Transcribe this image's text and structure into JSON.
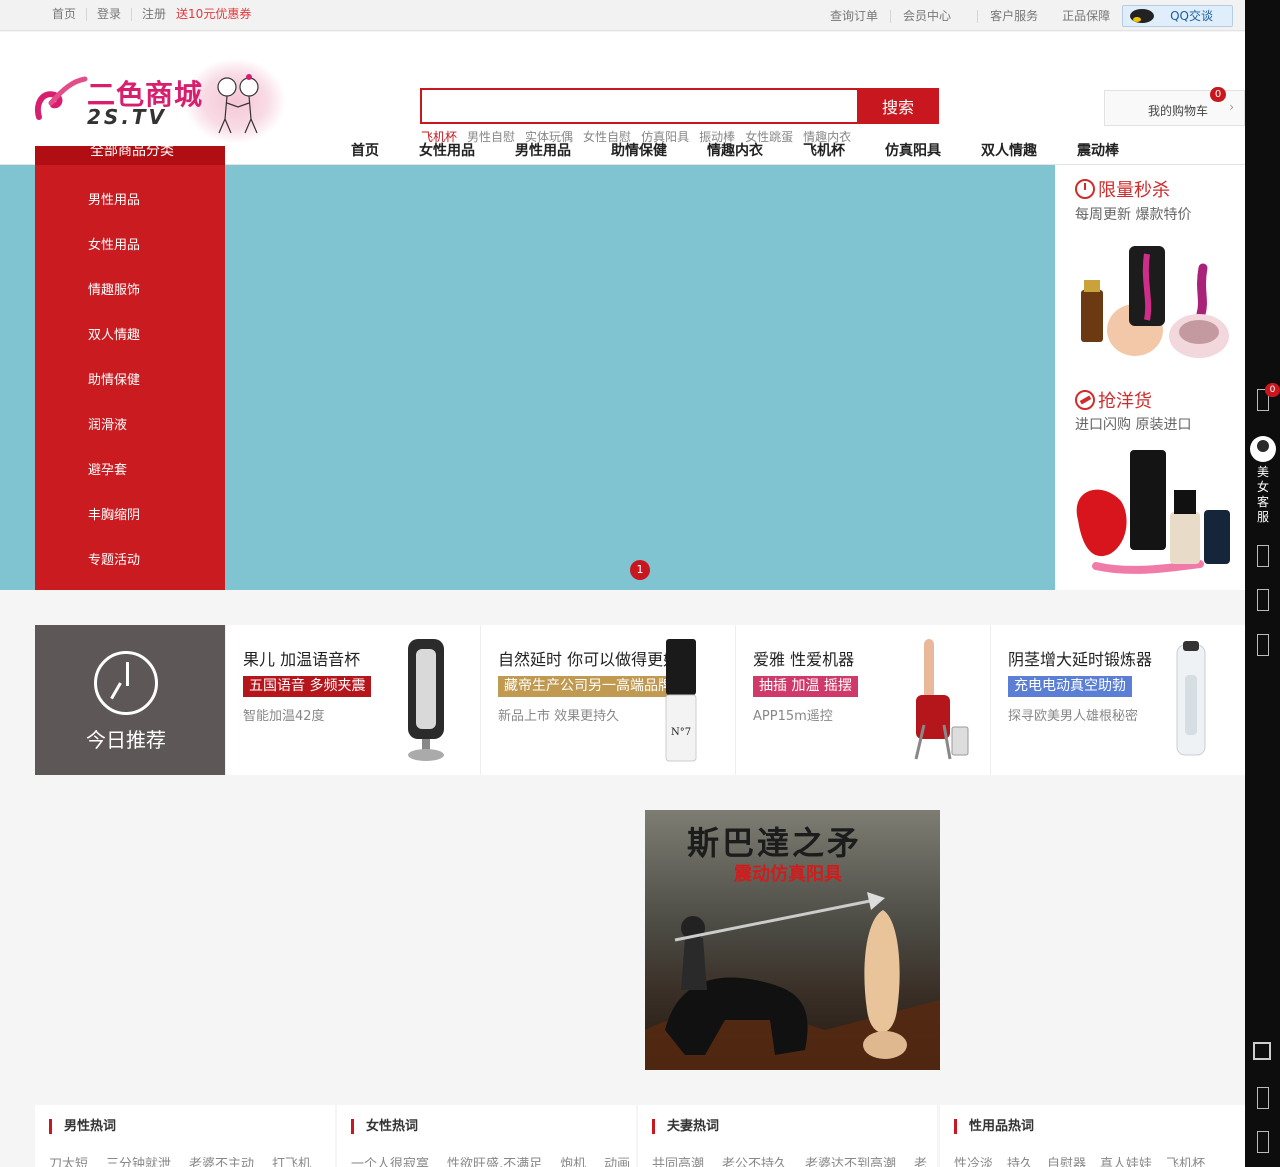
{
  "topbar": {
    "left": [
      "首页",
      "登录",
      "注册"
    ],
    "coupon": "送10元优惠券",
    "right": [
      "查询订单",
      "会员中心",
      "客户服务",
      "正品保障"
    ],
    "qq": "QQ交谈"
  },
  "logo": {
    "brand": "二色商城",
    "domain": "2S.TV"
  },
  "search": {
    "button": "搜索",
    "value": ""
  },
  "hotkeys": [
    "飞机杯",
    "男性自慰",
    "实体玩偶",
    "女性自慰",
    "仿真阳具",
    "振动棒",
    "女性跳蛋",
    "情趣内衣"
  ],
  "cart": {
    "label": "我的购物车",
    "count": "0"
  },
  "nav": [
    "首页",
    "女性用品",
    "男性用品",
    "助情保健",
    "情趣内衣",
    "飞机杯",
    "仿真阳具",
    "双人情趣",
    "震动棒"
  ],
  "category": {
    "header": "全部商品分类",
    "items": [
      "男性用品",
      "女性用品",
      "情趣服饰",
      "双人情趣",
      "助情保健",
      "润滑液",
      "避孕套",
      "丰胸缩阴",
      "专题活动"
    ]
  },
  "banner": {
    "page": "1",
    "color": "#80c3d1"
  },
  "promo": {
    "flash_title": "限量秒杀",
    "flash_sub": "每周更新 爆款特价",
    "import_title": "抢洋货",
    "import_sub": "进口闪购 原装进口"
  },
  "today": {
    "label": "今日推荐",
    "items": [
      {
        "title": "果儿 加温语音杯",
        "tag": "五国语音 多频夹震",
        "tag_color": "#b5161c",
        "sub": "智能加温42度"
      },
      {
        "title": "自然延时 你可以做得更好",
        "tag": "藏帝生产公司另一高端品牌",
        "tag_color": "#c19a52",
        "sub": "新品上市 效果更持久"
      },
      {
        "title": "爱雅 性爱机器",
        "tag": "抽插  加温  摇摆",
        "tag_color": "#d03a6a",
        "sub": "APP15m遥控"
      },
      {
        "title": "阴茎增大延时锻炼器",
        "tag": "充电电动真空助勃",
        "tag_color": "#5a7fd4",
        "sub": "探寻欧美男人雄根秘密"
      }
    ]
  },
  "poster": {
    "title": "斯巴達之矛",
    "subtitle": "震动仿真阳具"
  },
  "hot": [
    {
      "title": "男性热词",
      "words": [
        "刀太短",
        "三分钟就泄",
        "老婆不主动",
        "打飞机"
      ]
    },
    {
      "title": "女性热词",
      "words": [
        "一个人很寂寞",
        "性欲旺盛,不满足",
        "炮机",
        "动画"
      ]
    },
    {
      "title": "夫妻热词",
      "words": [
        "共同高潮",
        "老公不持久",
        "老婆达不到高潮",
        "老"
      ]
    },
    {
      "title": "性用品热词",
      "words": [
        "性冷淡",
        "持久",
        "自慰器",
        "真人娃娃",
        "飞机杯"
      ]
    }
  ],
  "sidebar": {
    "cart_count": "0",
    "service_label": "美女客服"
  }
}
